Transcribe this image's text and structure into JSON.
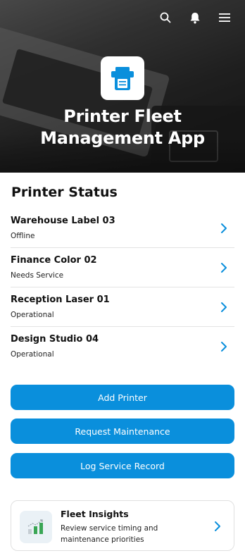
{
  "header": {
    "app_title": "Printer Fleet Management App",
    "icons": [
      "search-icon",
      "notification-icon",
      "menu-icon"
    ]
  },
  "printer_status": {
    "title": "Printer Status",
    "printers": [
      {
        "name": "Warehouse Label 03",
        "status": "Offline"
      },
      {
        "name": "Finance Color 02",
        "status": "Needs Service"
      },
      {
        "name": "Reception Laser 01",
        "status": "Operational"
      },
      {
        "name": "Design Studio 04",
        "status": "Operational"
      }
    ]
  },
  "actions": {
    "add_printer": "Add Printer",
    "request_maintenance": "Request Maintenance",
    "log_service_record": "Log Service Record"
  },
  "insights": {
    "title": "Fleet Insights",
    "description": "Review service timing and maintenance priorities"
  },
  "colors": {
    "accent": "#0a8fdc",
    "chart_green": "#3aa655"
  }
}
